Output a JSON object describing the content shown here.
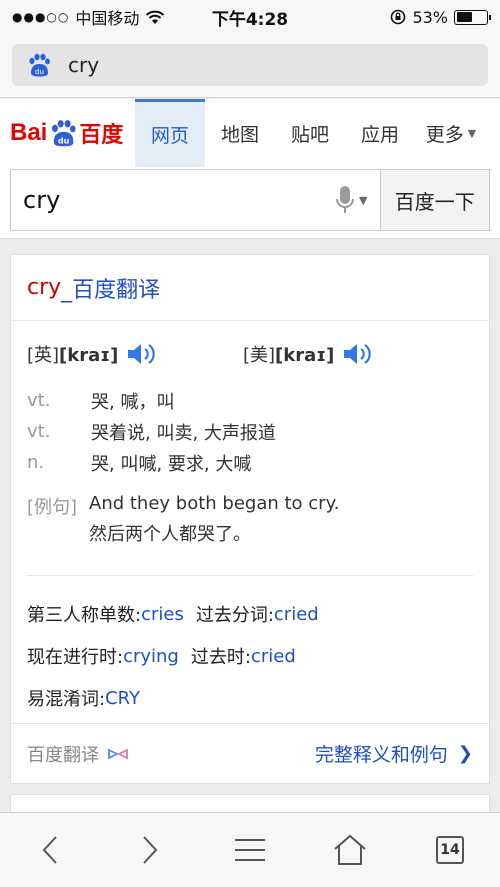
{
  "status_bar": {
    "carrier": "中国移动",
    "signal": "●●●○○",
    "time": "下午4:28",
    "battery_text": "53%",
    "battery_level": 0.53
  },
  "address": {
    "text": "cry"
  },
  "header": {
    "logo_latin": "Bai",
    "logo_cn": "百度",
    "tabs": [
      {
        "label": "网页"
      },
      {
        "label": "地图"
      },
      {
        "label": "贴吧"
      },
      {
        "label": "应用"
      }
    ],
    "more_label": "更多"
  },
  "search": {
    "query": "cry",
    "button_label": "百度一下"
  },
  "result": {
    "title_highlight": "cry",
    "title_rest": "_百度翻译",
    "uk_label": "[英]",
    "uk_phonetic": "[kraɪ]",
    "us_label": "[美]",
    "us_phonetic": "[kraɪ]",
    "definitions": [
      {
        "pos": "vt.",
        "meaning": "哭, 喊，叫"
      },
      {
        "pos": "vt.",
        "meaning": "哭着说, 叫卖, 大声报道"
      },
      {
        "pos": "n.",
        "meaning": "哭, 叫喊, 要求, 大喊"
      }
    ],
    "example_label": "[例句]",
    "example_en": "And they both began to cry.",
    "example_cn": "然后两个人都哭了。",
    "forms": {
      "third_person_label": "第三人称单数: ",
      "third_person": "cries",
      "past_participle_label": "过去分词: ",
      "past_participle": "cried",
      "present_participle_label": "现在进行时: ",
      "present_participle": "crying",
      "past_label": "过去时: ",
      "past": "cried",
      "confusable_label": "易混淆词: ",
      "confusable": "CRY"
    },
    "footer_source": "百度翻译",
    "footer_link": "完整释义和例句"
  },
  "toolbar": {
    "tab_count": "14"
  }
}
